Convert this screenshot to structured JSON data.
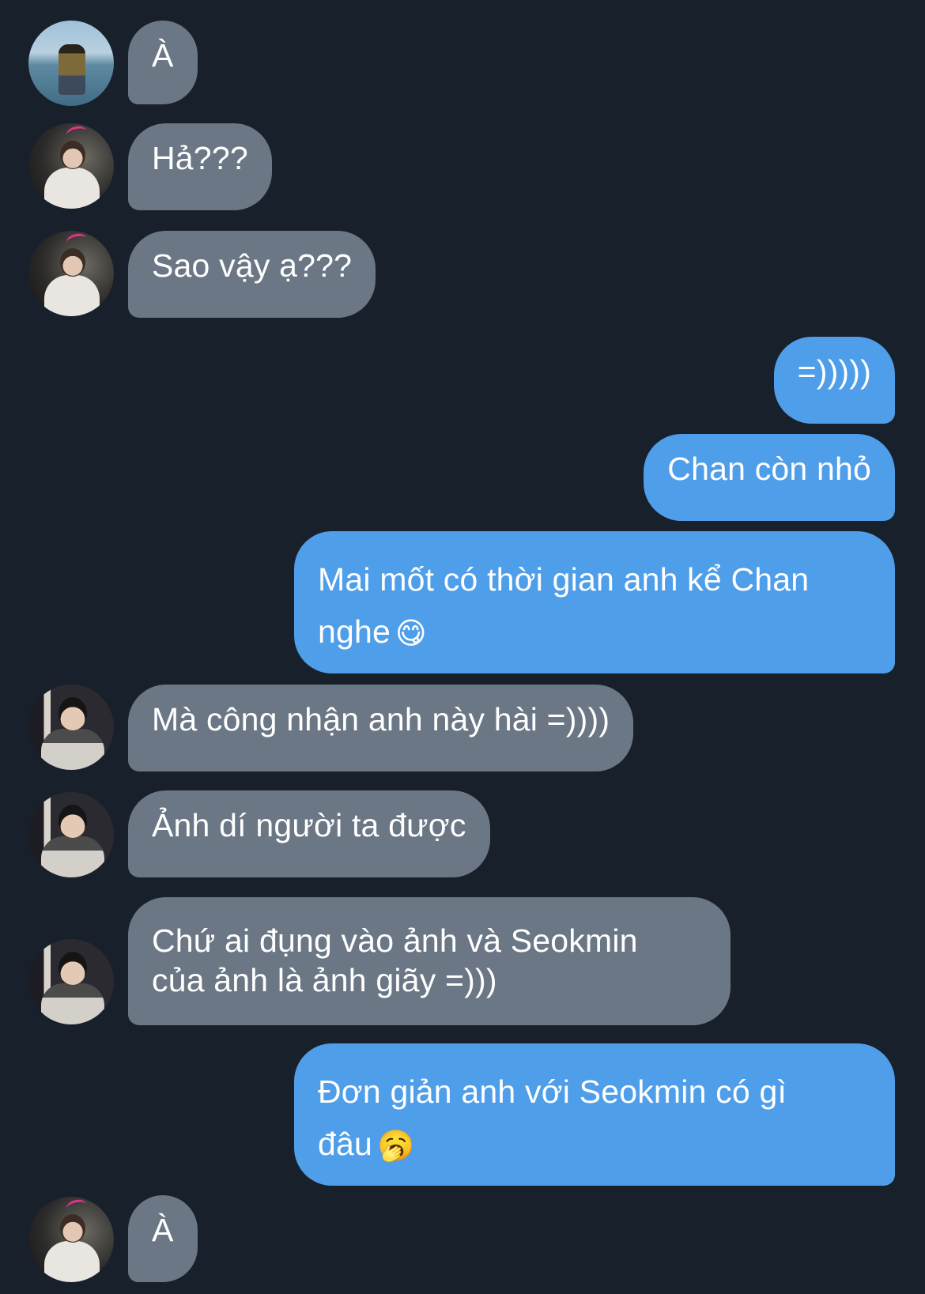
{
  "colors": {
    "background": "#18202b",
    "incoming_bubble": "#6b7785",
    "outgoing_bubble": "#4f9ee9",
    "text": "#ffffff"
  },
  "messages": [
    {
      "side": "incoming",
      "avatar": "beach-photo",
      "text": "À"
    },
    {
      "side": "incoming",
      "avatar": "boy-photo-a",
      "text": "Hả???"
    },
    {
      "side": "incoming",
      "avatar": "boy-photo-a",
      "text": "Sao vậy ạ???"
    },
    {
      "side": "outgoing",
      "text": "=)))))"
    },
    {
      "side": "outgoing",
      "text": "Chan còn nhỏ"
    },
    {
      "side": "outgoing",
      "text_line1": "Mai mốt có thời gian anh kể Chan",
      "text_line2": "nghe",
      "emoji": "😋"
    },
    {
      "side": "incoming",
      "avatar": "boy-photo-b",
      "text": "Mà công nhận anh này hài =))))"
    },
    {
      "side": "incoming",
      "avatar": "boy-photo-b",
      "text": "Ảnh dí người ta được"
    },
    {
      "side": "incoming",
      "avatar": "boy-photo-b",
      "text_line1": "Chứ ai đụng vào ảnh và Seokmin",
      "text_line2": "của ảnh là ảnh giãy =)))"
    },
    {
      "side": "outgoing",
      "text_line1": "Đơn giản anh với Seokmin có gì",
      "text_line2": "đâu",
      "emoji": "🥱"
    },
    {
      "side": "incoming",
      "avatar": "boy-photo-a",
      "text": "À"
    }
  ]
}
